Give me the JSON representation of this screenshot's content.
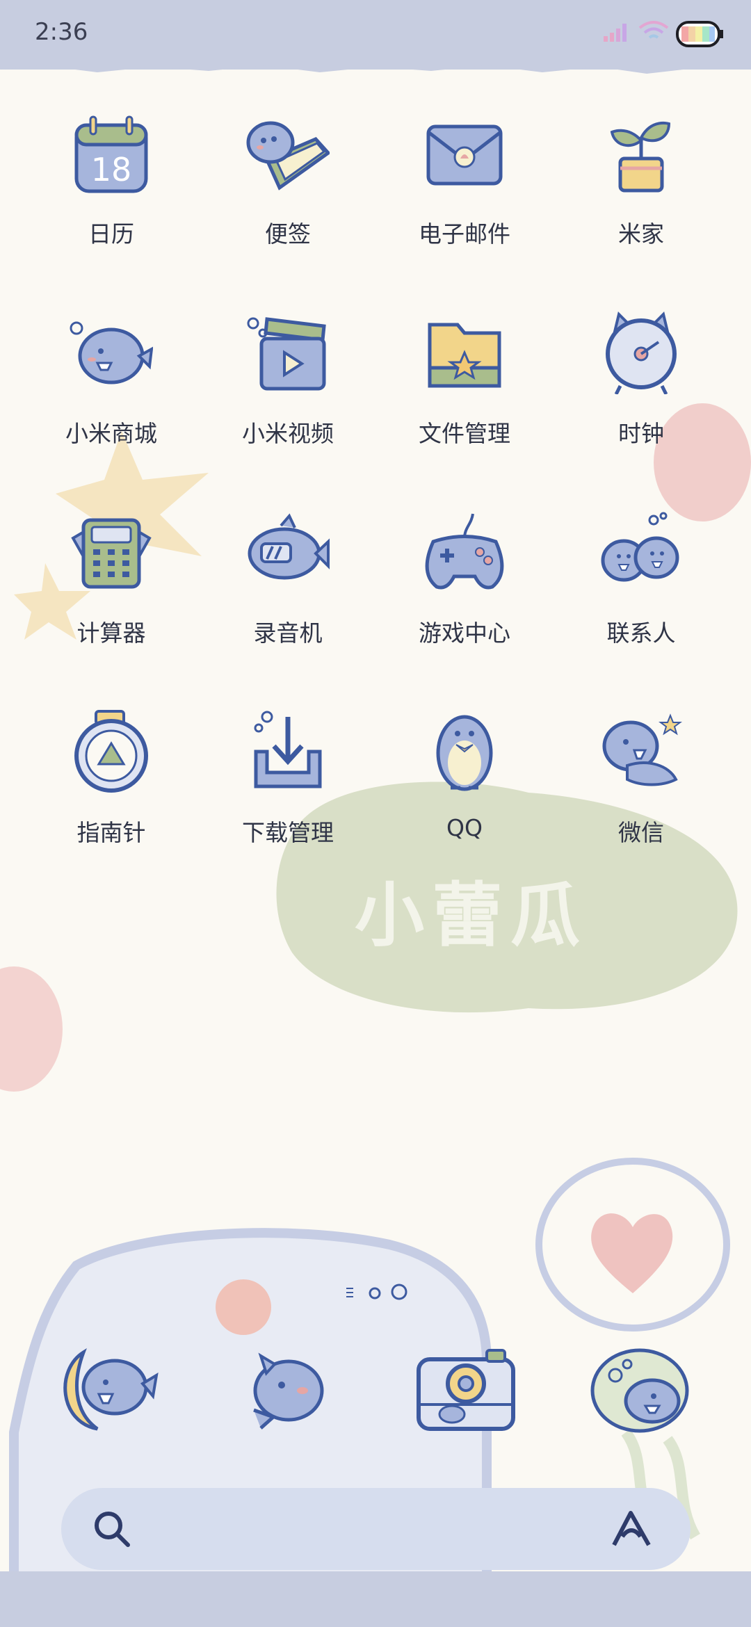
{
  "status_bar": {
    "time": "2:36"
  },
  "apps": [
    {
      "label": "日历",
      "icon": "calendar-icon",
      "date": "18"
    },
    {
      "label": "便签",
      "icon": "notes-icon"
    },
    {
      "label": "电子邮件",
      "icon": "mail-icon"
    },
    {
      "label": "米家",
      "icon": "plant-icon"
    },
    {
      "label": "小米商城",
      "icon": "shark-store-icon"
    },
    {
      "label": "小米视频",
      "icon": "video-icon"
    },
    {
      "label": "文件管理",
      "icon": "folder-icon"
    },
    {
      "label": "时钟",
      "icon": "clock-icon"
    },
    {
      "label": "计算器",
      "icon": "calculator-icon"
    },
    {
      "label": "录音机",
      "icon": "recorder-icon"
    },
    {
      "label": "游戏中心",
      "icon": "gamepad-icon"
    },
    {
      "label": "联系人",
      "icon": "contacts-icon"
    },
    {
      "label": "指南针",
      "icon": "compass-icon"
    },
    {
      "label": "下载管理",
      "icon": "download-icon"
    },
    {
      "label": "QQ",
      "icon": "penguin-icon"
    },
    {
      "label": "微信",
      "icon": "wechat-shark-icon"
    }
  ],
  "wallpaper_text": "小蕾瓜",
  "dock": [
    {
      "icon": "moon-shark-icon"
    },
    {
      "icon": "shark-icon"
    },
    {
      "icon": "camera-icon"
    },
    {
      "icon": "bubble-shark-icon"
    }
  ],
  "colors": {
    "status": "#c7cde0",
    "background": "#fbf9f3",
    "icon_blue": "#a6b5dc",
    "outline": "#3d5aa0",
    "green": "#a9bd8c",
    "yellow": "#f2d58a",
    "pink": "#e6a6a4"
  }
}
